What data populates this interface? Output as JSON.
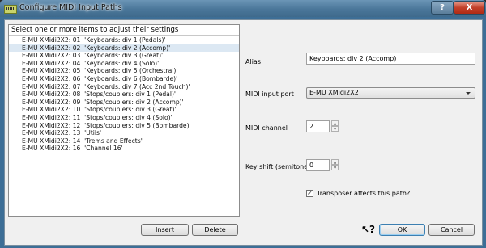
{
  "window": {
    "title": "Configure MIDI Input Paths",
    "help_label": "?",
    "close_label": "X"
  },
  "list": {
    "header": "Select one or more items to adjust their settings",
    "items": [
      "E-MU XMidi2X2: 01  'Keyboards: div 1 (Pedals)'",
      "E-MU XMidi2X2: 02  'Keyboards: div 2 (Accomp)'",
      "E-MU XMidi2X2: 03  'Keyboards: div 3 (Great)'",
      "E-MU XMidi2X2: 04  'Keyboards: div 4 (Solo)'",
      "E-MU XMidi2X2: 05  'Keyboards: div 5 (Orchestral)'",
      "E-MU XMidi2X2: 06  'Keyboards: div 6 (Bombarde)'",
      "E-MU XMidi2X2: 07  'Keyboards: div 7 (Acc 2nd Touch)'",
      "E-MU XMidi2X2: 08  'Stops/couplers: div 1 (Pedal)'",
      "E-MU XMidi2X2: 09  'Stops/couplers: div 2 (Accomp)'",
      "E-MU XMidi2X2: 10  'Stops/couplers: div 3 (Great)'",
      "E-MU XMidi2X2: 11  'Stops/couplers: div 4 (Solo)'",
      "E-MU XMidi2X2: 12  'Stops/couplers: div 5 (Bombarde)'",
      "E-MU XMidi2X2: 13  'Utils'",
      "E-MU XMidi2X2: 14  'Trems and Effects'",
      "E-MU XMidi2X2: 16  'Channel 16'"
    ]
  },
  "buttons": {
    "insert": "Insert",
    "delete": "Delete",
    "ok": "OK",
    "cancel": "Cancel"
  },
  "form": {
    "alias_label": "Alias",
    "alias_value": "Keyboards: div 2 (Accomp)",
    "port_label": "MIDI input port",
    "port_value": "E-MU XMidi2X2",
    "channel_label": "MIDI channel",
    "channel_value": "2",
    "keyshift_label": "Key shift (semitones)",
    "keyshift_value": "0",
    "transposer_label": "Transposer affects this path?",
    "transposer_checked": true
  },
  "icons": {
    "whats_this": "whats-this-icon"
  }
}
